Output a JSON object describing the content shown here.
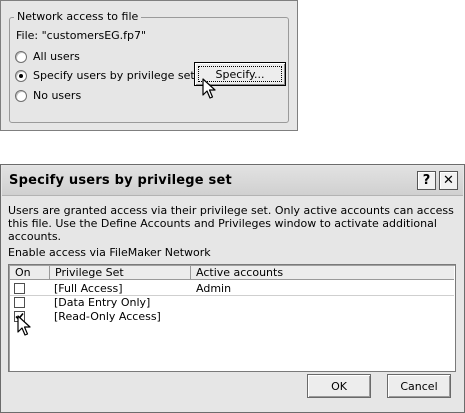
{
  "network_panel": {
    "group_label": "Network access to file",
    "file_line": "File: \"customersEG.fp7\"",
    "options": [
      {
        "label": "All users",
        "selected": false
      },
      {
        "label": "Specify users by privilege set",
        "selected": true
      },
      {
        "label": "No users",
        "selected": false
      }
    ],
    "specify_button": "Specify..."
  },
  "dialog": {
    "title": "Specify users by privilege set",
    "help_glyph": "?",
    "close_glyph": "✕",
    "description": "Users are granted access via their privilege set. Only active accounts can access this file. Use the Define Accounts and Privileges window to activate additional accounts.",
    "enable_label": "Enable access via FileMaker Network",
    "columns": {
      "on": "On",
      "privilege_set": "Privilege Set",
      "active_accounts": "Active accounts"
    },
    "rows": [
      {
        "checked": false,
        "privilege_set": "[Full Access]",
        "active_accounts": "Admin"
      },
      {
        "checked": false,
        "privilege_set": "[Data Entry Only]",
        "active_accounts": ""
      },
      {
        "checked": true,
        "privilege_set": "[Read-Only Access]",
        "active_accounts": ""
      }
    ],
    "ok_button": "OK",
    "cancel_button": "Cancel"
  }
}
